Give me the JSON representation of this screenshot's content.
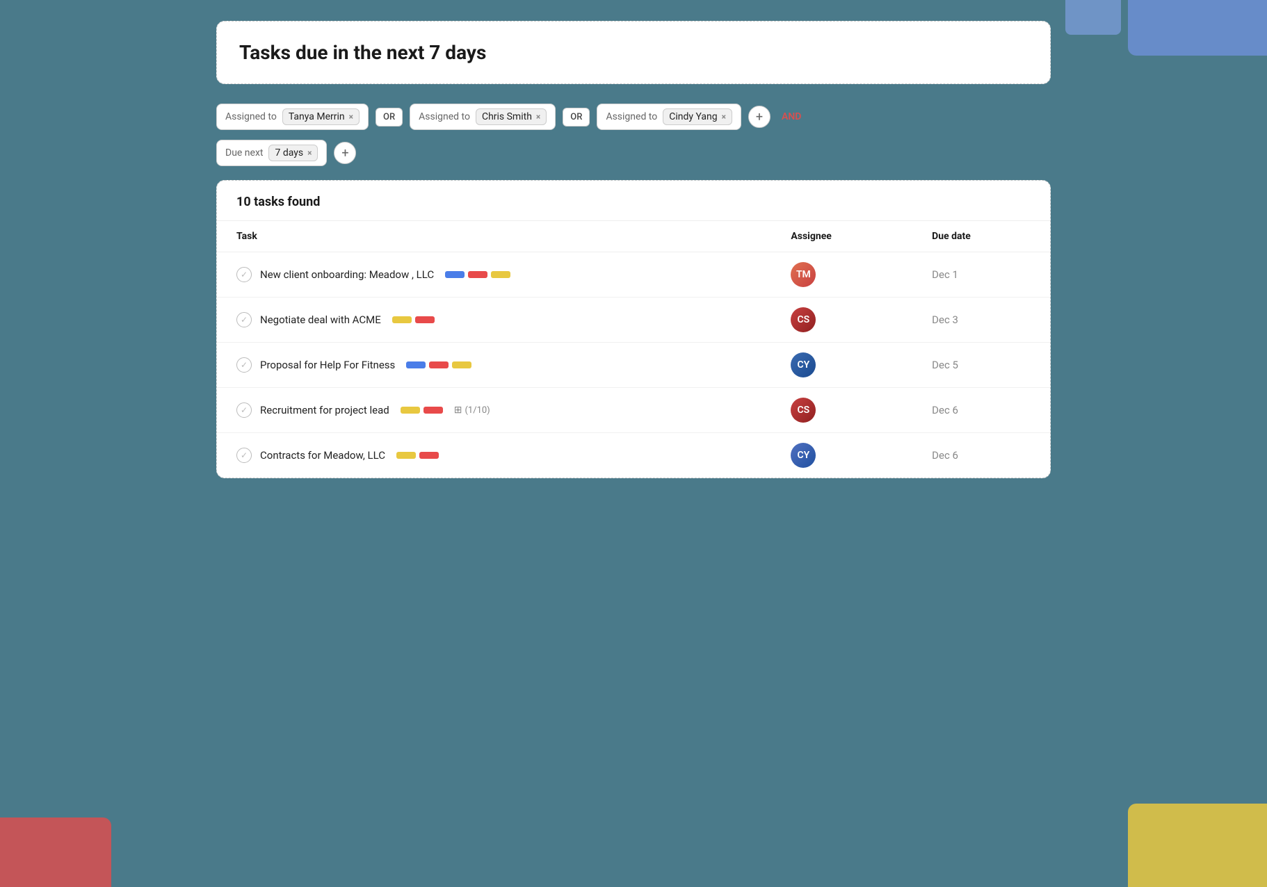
{
  "decorative": {
    "corner_top_right": "top-right decorative block",
    "corner_bottom_left": "bottom-left decorative block",
    "corner_bottom_right": "bottom-right decorative block"
  },
  "title_card": {
    "title": "Tasks due in the next 7 days"
  },
  "filters": {
    "row1": [
      {
        "label": "Assigned to",
        "tag": "Tanya Merrin",
        "connector": "OR"
      },
      {
        "label": "Assigned to",
        "tag": "Chris Smith",
        "connector": "OR"
      },
      {
        "label": "Assigned to",
        "tag": "Cindy Yang",
        "connector": ""
      }
    ],
    "and_label": "AND",
    "row2": [
      {
        "label": "Due next",
        "tag": "7 days"
      }
    ]
  },
  "results": {
    "summary": "10 tasks found",
    "columns": {
      "task": "Task",
      "assignee": "Assignee",
      "due_date": "Due date"
    },
    "tasks": [
      {
        "id": 1,
        "name": "New client onboarding: Meadow , LLC",
        "tags": [
          "blue",
          "red",
          "yellow"
        ],
        "subtask": null,
        "assignee": "Tanya Merrin",
        "avatar_type": "female-red",
        "due": "Dec 1"
      },
      {
        "id": 2,
        "name": "Negotiate deal with ACME",
        "tags": [
          "yellow",
          "red"
        ],
        "subtask": null,
        "assignee": "Chris Smith",
        "avatar_type": "female-dark-red",
        "due": "Dec 3"
      },
      {
        "id": 3,
        "name": "Proposal for Help For Fitness",
        "tags": [
          "blue",
          "red",
          "yellow"
        ],
        "subtask": null,
        "assignee": "Cindy Yang",
        "avatar_type": "male-blue",
        "due": "Dec 5"
      },
      {
        "id": 4,
        "name": "Recruitment for project lead",
        "tags": [
          "yellow",
          "red"
        ],
        "subtask": "(1/10)",
        "assignee": "Chris Smith",
        "avatar_type": "female-dark-red",
        "due": "Dec 6"
      },
      {
        "id": 5,
        "name": "Contracts for Meadow, LLC",
        "tags": [
          "yellow",
          "red"
        ],
        "subtask": null,
        "assignee": "Cindy Yang",
        "avatar_type": "female-blue",
        "due": "Dec 6"
      }
    ]
  }
}
